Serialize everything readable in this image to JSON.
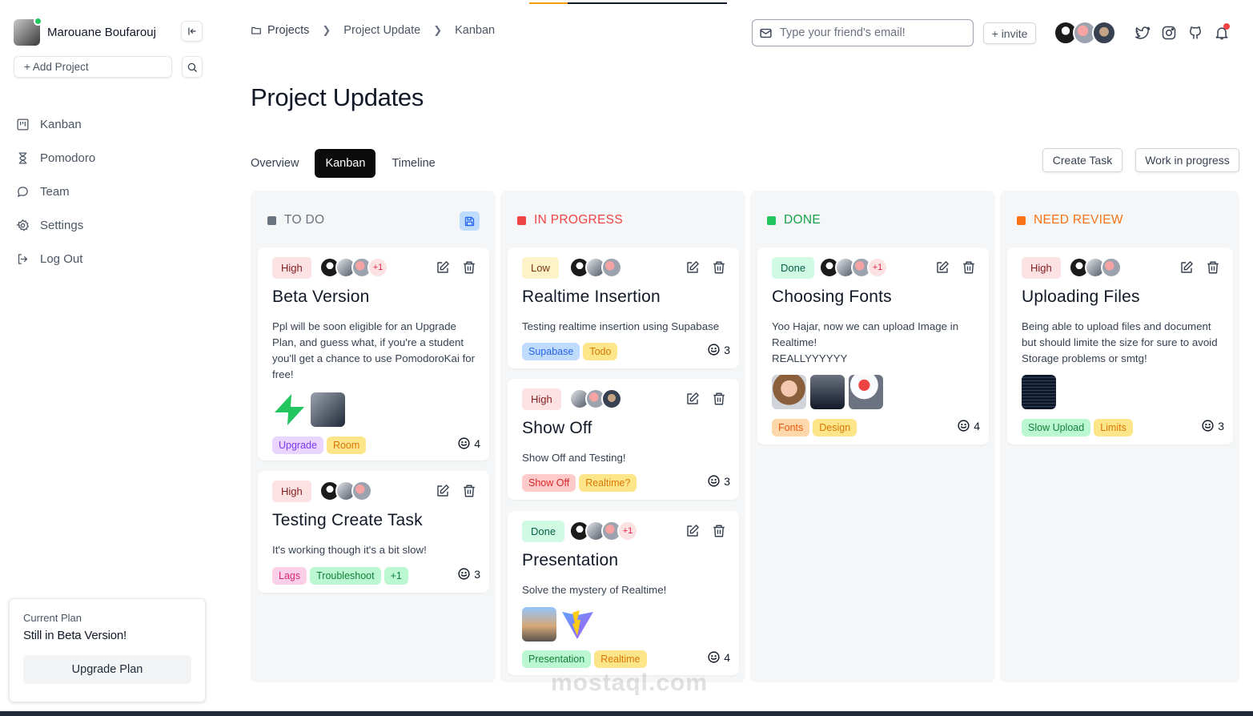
{
  "user": {
    "name": "Marouane Boufarouj"
  },
  "sidebar": {
    "add_project": "+ Add Project",
    "items": [
      {
        "label": "Kanban",
        "icon": "kanban-icon"
      },
      {
        "label": "Pomodoro",
        "icon": "hourglass-icon"
      },
      {
        "label": "Team",
        "icon": "chat-icon"
      },
      {
        "label": "Settings",
        "icon": "gear-icon"
      },
      {
        "label": "Log Out",
        "icon": "logout-icon"
      }
    ],
    "plan": {
      "label": "Current Plan",
      "title": "Still in Beta Version!",
      "button": "Upgrade Plan"
    }
  },
  "header": {
    "breadcrumb": [
      "Projects",
      "Project Update",
      "Kanban"
    ],
    "email_placeholder": "Type your friend's email!",
    "invite": "+ invite"
  },
  "page": {
    "title": "Project Updates",
    "tabs": [
      "Overview",
      "Kanban",
      "Timeline"
    ],
    "active_tab": "Kanban",
    "create_task": "Create Task",
    "status_select": "Work in progress"
  },
  "colors": {
    "todo": "#6b7280",
    "in_progress": "#ef4444",
    "done": "#22c55e",
    "need_review": "#f97316",
    "accent": "#0b0b0b"
  },
  "columns": [
    {
      "title": "TO DO",
      "cards": [
        {
          "priority": "High",
          "extra_members": "+1",
          "title": "Beta Version",
          "description": "Ppl will be soon eligible for an Upgrade Plan, and guess what, if you're a student you'll get a chance to use PomodoroKai for free!",
          "tags": [
            "Upgrade",
            "Room"
          ],
          "comments": "4"
        },
        {
          "priority": "High",
          "title": "Testing Create Task",
          "description": "It's working though it's a bit slow!",
          "tags": [
            "Lags",
            "Troubleshoot",
            "+1"
          ],
          "comments": "3"
        }
      ]
    },
    {
      "title": "IN PROGRESS",
      "cards": [
        {
          "priority": "Low",
          "title": "Realtime Insertion",
          "description": "Testing realtime insertion using Supabase",
          "tags": [
            "Supabase",
            "Todo"
          ],
          "comments": "3"
        },
        {
          "priority": "High",
          "title": "Show Off",
          "description": "Show Off and Testing!",
          "tags": [
            "Show Off",
            "Realtime?"
          ],
          "comments": "3"
        },
        {
          "priority": "Done",
          "extra_members": "+1",
          "title": "Presentation",
          "description": "Solve the mystery of Realtime!",
          "tags": [
            "Presentation",
            "Realtime"
          ],
          "comments": "4"
        }
      ]
    },
    {
      "title": "DONE",
      "cards": [
        {
          "priority": "Done",
          "extra_members": "+1",
          "title": "Choosing Fonts",
          "description": "Yoo Hajar, now we can upload Image in Realtime!\nREALLYYYYYY",
          "tags": [
            "Fonts",
            "Design"
          ],
          "comments": "4"
        }
      ]
    },
    {
      "title": "NEED REVIEW",
      "cards": [
        {
          "priority": "High",
          "title": "Uploading Files",
          "description": "Being able to upload files and document but should limite the size for sure to avoid Storage problems or smtg!",
          "tags": [
            "Slow Upload",
            "Limits"
          ],
          "comments": "3"
        }
      ]
    }
  ],
  "watermark": "mostaql.com"
}
